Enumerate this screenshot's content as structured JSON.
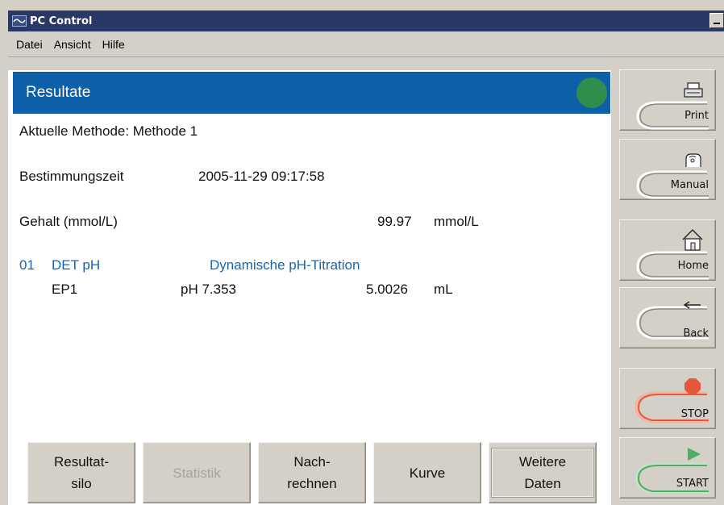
{
  "window": {
    "title": "PC Control"
  },
  "menu": {
    "datei": "Datei",
    "ansicht": "Ansicht",
    "hilfe": "Hilfe"
  },
  "header": {
    "title": "Resultate",
    "status_color": "#2f8e4e"
  },
  "content": {
    "method": "Aktuelle Methode: Methode 1",
    "time_label": "Bestimmungszeit",
    "time_value": "2005-11-29 09:17:58",
    "content_label": "Gehalt (mmol/L)",
    "content_value": "99.97",
    "content_unit": "mmol/L",
    "step_number": "01",
    "step_command": "DET pH",
    "step_description": "Dynamische pH-Titration",
    "ep_label": "EP1",
    "ep_ph": "pH 7.353",
    "ep_volume": "5.0026",
    "ep_unit": "mL"
  },
  "buttons": {
    "resultatsilo_1": "Resultat-",
    "resultatsilo_2": "silo",
    "statistik": "Statistik",
    "nachrechnen_1": "Nach-",
    "nachrechnen_2": "rechnen",
    "kurve": "Kurve",
    "weitere_1": "Weitere",
    "weitere_2": "Daten"
  },
  "side": {
    "print": "Print",
    "manual": "Manual",
    "home": "Home",
    "back": "Back",
    "stop": "STOP",
    "start": "START"
  },
  "colors": {
    "header_blue": "#0d5fa8",
    "stop_accent": "#e8573c",
    "start_accent": "#4fae64"
  }
}
